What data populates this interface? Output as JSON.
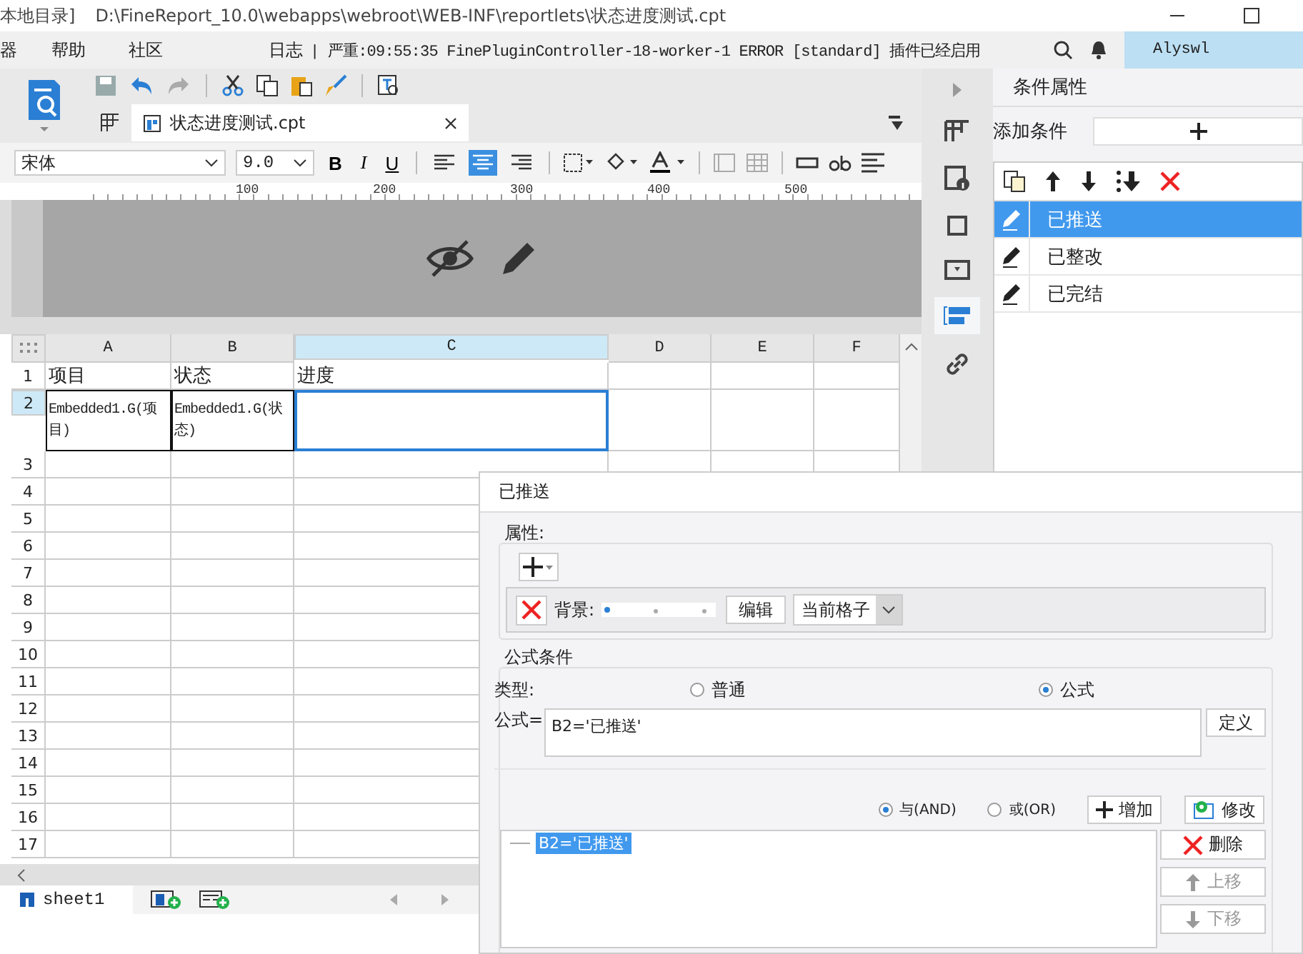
{
  "title_bar": {
    "title": "本地目录]",
    "path": "D:\\FineReport_10.0\\webapps\\webroot\\WEB-INF\\reportlets\\状态进度测试.cpt"
  },
  "menu": [
    "器",
    "帮助",
    "社区"
  ],
  "log": {
    "label": "日志",
    "message": "| 严重:09:55:35 FinePluginController-18-worker-1 ERROR [standard] 插件已经启用"
  },
  "user": "Alyswl",
  "file_tab": {
    "label": "状态进度测试.cpt"
  },
  "format_bar": {
    "font": "宋体",
    "size": "9.0",
    "bold": "B",
    "italic": "I",
    "underline": "U",
    "alignments": [
      {
        "kind": "left",
        "selected": false
      },
      {
        "kind": "center",
        "selected": true
      },
      {
        "kind": "right",
        "selected": false
      }
    ]
  },
  "ruler": [
    "100",
    "200",
    "300",
    "400",
    "500"
  ],
  "sheet": {
    "columns": [
      {
        "label": "A",
        "selected": false
      },
      {
        "label": "B",
        "selected": false
      },
      {
        "label": "C",
        "selected": true
      },
      {
        "label": "D",
        "selected": false
      },
      {
        "label": "E",
        "selected": false
      },
      {
        "label": "F",
        "selected": false
      }
    ],
    "rows": [
      {
        "label": "1",
        "selected": false,
        "cells": [
          {
            "text": "项目"
          },
          {
            "text": "状态"
          },
          {
            "text": "进度"
          }
        ]
      },
      {
        "label": "2",
        "selected": true,
        "cells": [
          {
            "text": "Embedded1.G(项目)"
          },
          {
            "text": "Embedded1.G(状态)"
          }
        ]
      },
      {
        "label": "3",
        "selected": false,
        "cells": []
      },
      {
        "label": "4",
        "selected": false,
        "cells": []
      },
      {
        "label": "5",
        "selected": false,
        "cells": []
      },
      {
        "label": "6",
        "selected": false,
        "cells": []
      },
      {
        "label": "7",
        "selected": false,
        "cells": []
      },
      {
        "label": "8",
        "selected": false,
        "cells": []
      },
      {
        "label": "9",
        "selected": false,
        "cells": []
      },
      {
        "label": "10",
        "selected": false,
        "cells": []
      },
      {
        "label": "11",
        "selected": false,
        "cells": []
      },
      {
        "label": "12",
        "selected": false,
        "cells": []
      },
      {
        "label": "13",
        "selected": false,
        "cells": []
      },
      {
        "label": "14",
        "selected": false,
        "cells": []
      },
      {
        "label": "15",
        "selected": false,
        "cells": []
      },
      {
        "label": "16",
        "selected": false,
        "cells": []
      },
      {
        "label": "17",
        "selected": false,
        "cells": []
      }
    ]
  },
  "sheet_tabs": [
    {
      "label": "sheet1",
      "selected": true
    }
  ],
  "right_panel": {
    "title": "条件属性",
    "add_label": "添加条件",
    "conditions": [
      {
        "label": "已推送",
        "selected": true
      },
      {
        "label": "已整改",
        "selected": false
      },
      {
        "label": "已完结",
        "selected": false
      }
    ]
  },
  "dialog": {
    "title": "已推送",
    "properties_label": "属性:",
    "property": {
      "label": "背景:",
      "edit": "编辑",
      "scope": "当前格子"
    },
    "formula_section": "公式条件",
    "type_label": "类型:",
    "types": [
      {
        "label": "普通",
        "selected": false
      },
      {
        "label": "公式",
        "selected": true
      }
    ],
    "formula_label": "公式=",
    "formula": "B2='已推送'",
    "define": "定义",
    "joins": [
      {
        "label": "与(AND)",
        "selected": true
      },
      {
        "label": "或(OR)",
        "selected": false
      }
    ],
    "add": "增加",
    "modify": "修改",
    "conditions": [
      {
        "text": "B2='已推送'",
        "selected": true
      }
    ],
    "actions": [
      {
        "kind": "delete",
        "label": "删除",
        "disabled": false
      },
      {
        "kind": "up",
        "label": "上移",
        "disabled": true
      },
      {
        "kind": "down",
        "label": "下移",
        "disabled": true
      }
    ]
  }
}
